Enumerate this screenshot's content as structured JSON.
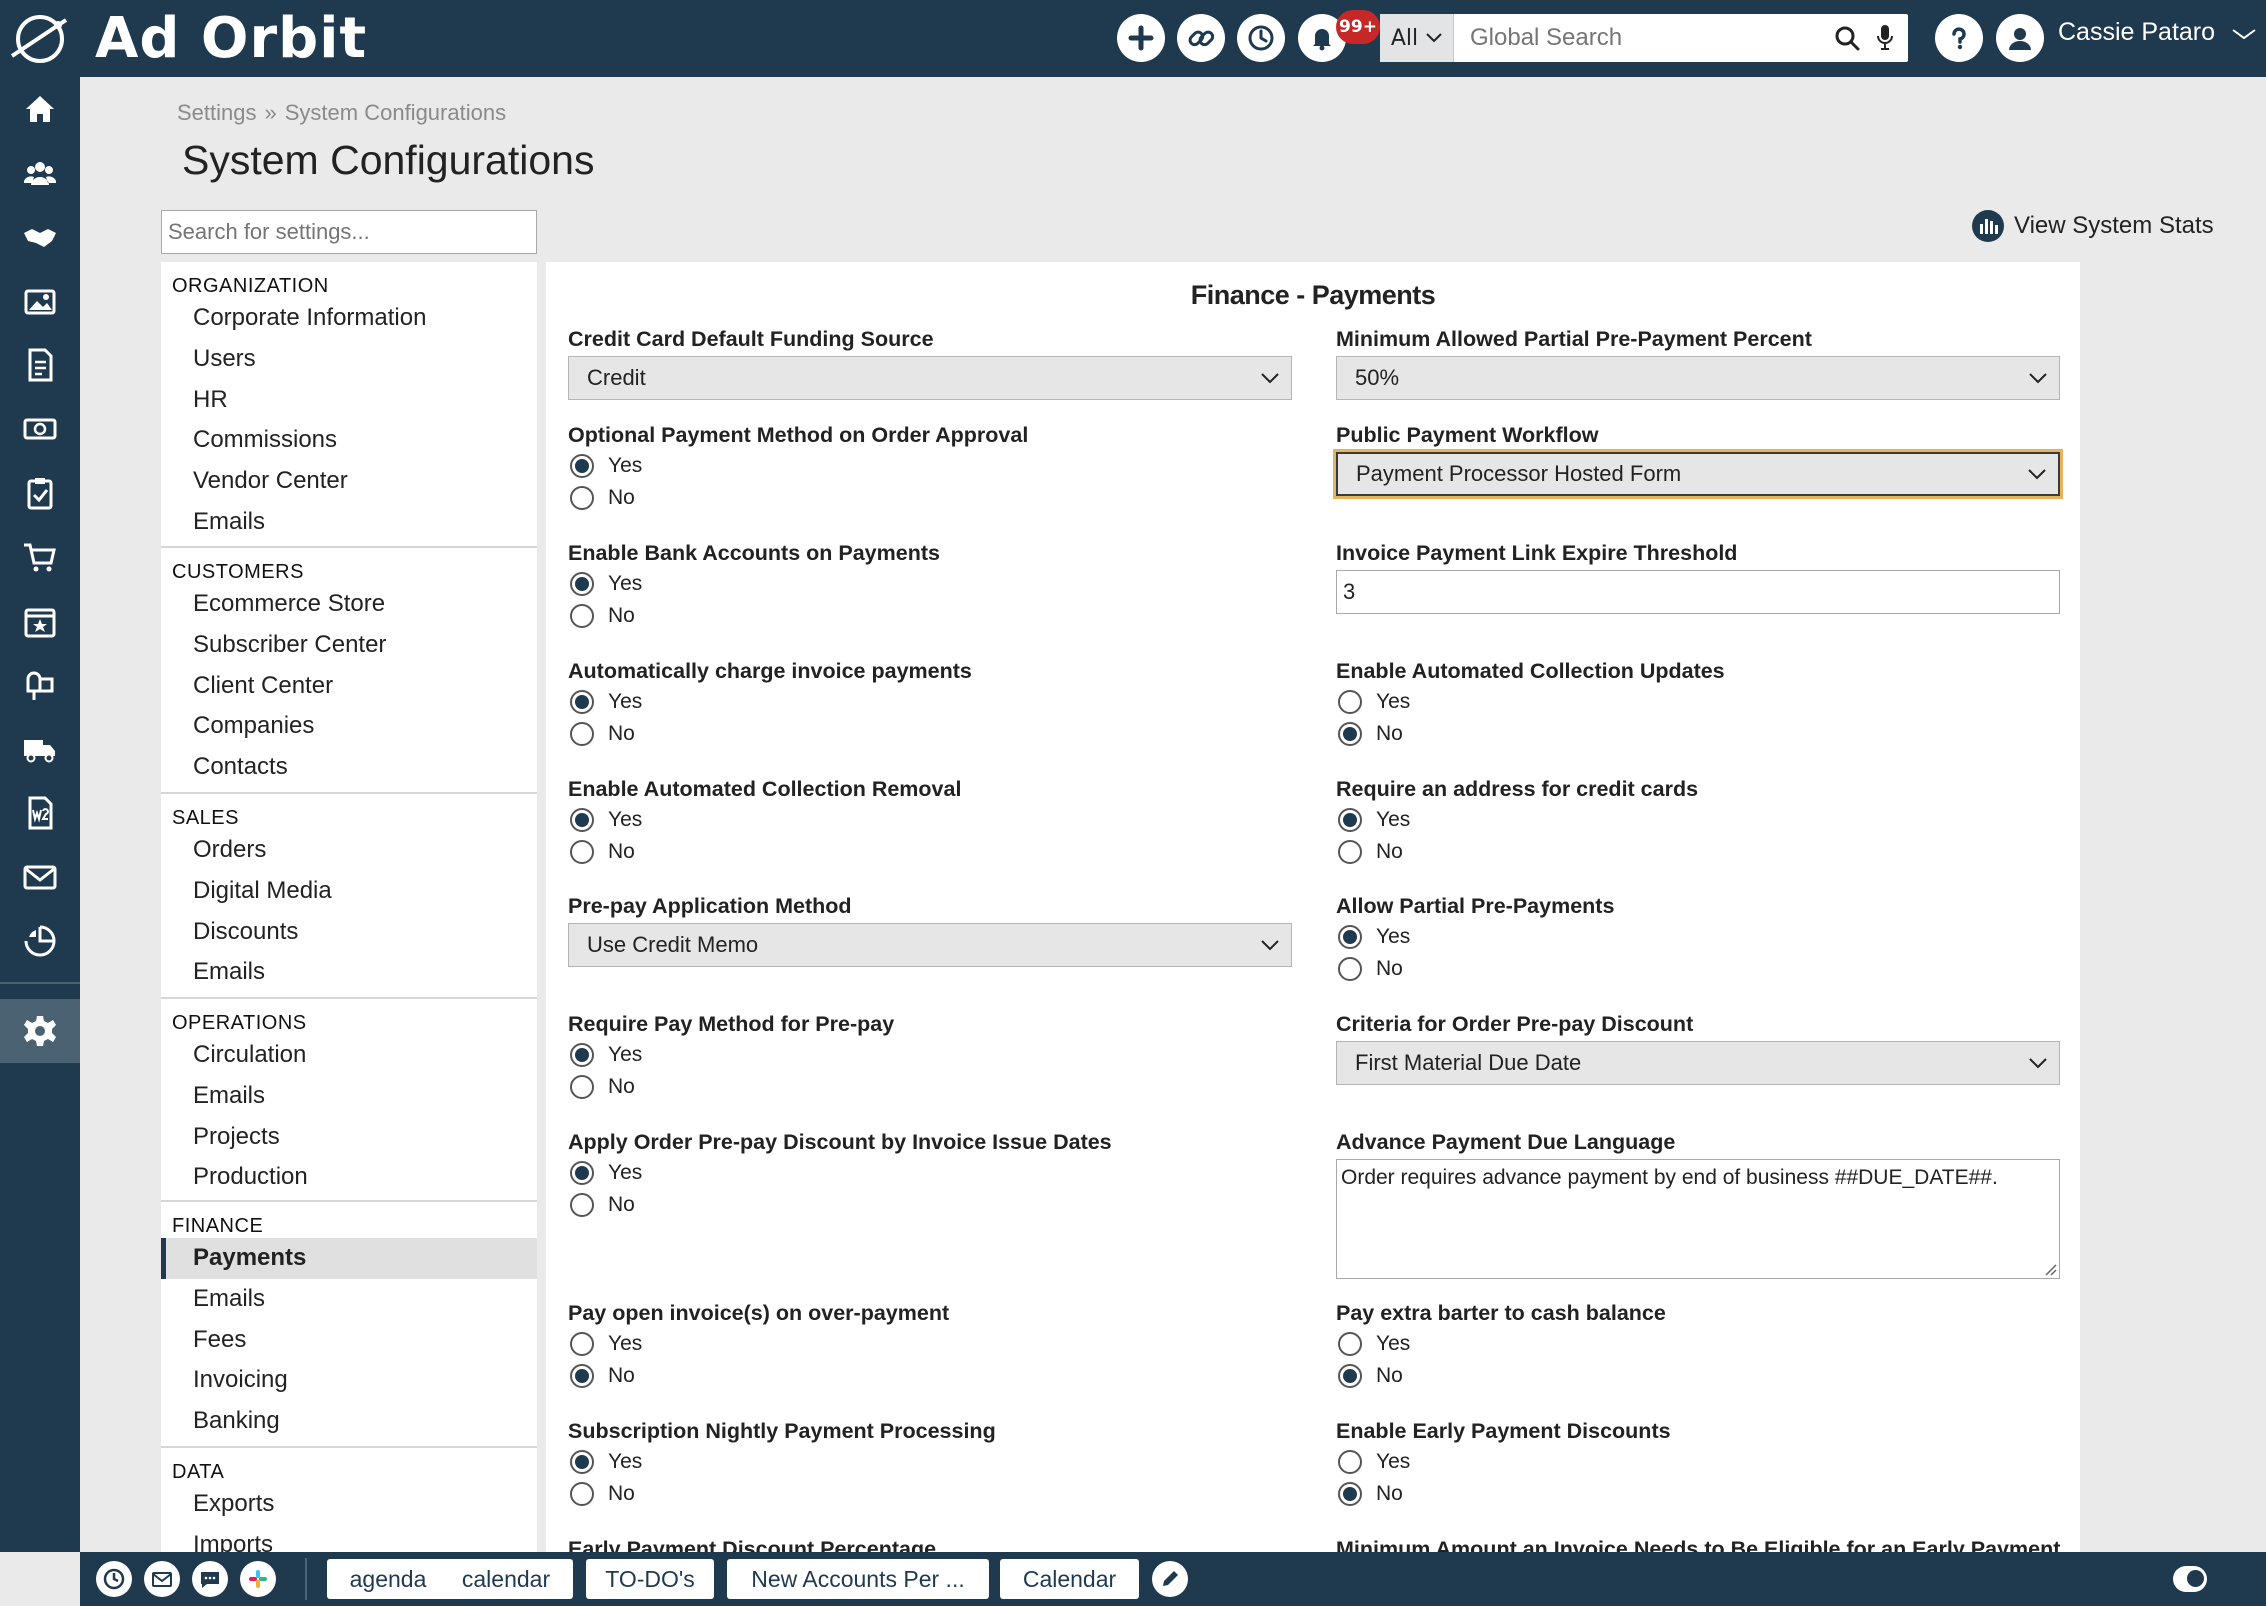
{
  "header": {
    "brand": "Ad Orbit",
    "notifications_badge": "99+",
    "search_scope": "All",
    "search_placeholder": "Global Search",
    "user_name": "Cassie Pataro"
  },
  "breadcrumb": {
    "parent": "Settings",
    "separator": "»",
    "current": "System Configurations"
  },
  "page_title": "System Configurations",
  "settings_search_placeholder": "Search for settings...",
  "view_stats_label": "View System Stats",
  "nav": {
    "organization": {
      "title": "ORGANIZATION",
      "items": [
        "Corporate Information",
        "Users",
        "HR",
        "Commissions",
        "Vendor Center",
        "Emails"
      ]
    },
    "customers": {
      "title": "CUSTOMERS",
      "items": [
        "Ecommerce Store",
        "Subscriber Center",
        "Client Center",
        "Companies",
        "Contacts"
      ]
    },
    "sales": {
      "title": "SALES",
      "items": [
        "Orders",
        "Digital Media",
        "Discounts",
        "Emails"
      ]
    },
    "operations": {
      "title": "OPERATIONS",
      "items": [
        "Circulation",
        "Emails",
        "Projects",
        "Production"
      ]
    },
    "finance": {
      "title": "FINANCE",
      "items": [
        "Payments",
        "Emails",
        "Fees",
        "Invoicing",
        "Banking"
      ]
    },
    "data": {
      "title": "DATA",
      "items": [
        "Exports",
        "Imports"
      ]
    }
  },
  "panel": {
    "title": "Finance - Payments",
    "yes": "Yes",
    "no": "No",
    "fields": {
      "cc_funding": {
        "label": "Credit Card Default Funding Source",
        "value": "Credit"
      },
      "min_partial": {
        "label": "Minimum Allowed Partial Pre-Payment Percent",
        "value": "50%"
      },
      "optional_pay_method": {
        "label": "Optional Payment Method on Order Approval",
        "selected": "Yes"
      },
      "public_workflow": {
        "label": "Public Payment Workflow",
        "value": "Payment Processor Hosted Form"
      },
      "bank_accounts": {
        "label": "Enable Bank Accounts on Payments",
        "selected": "Yes"
      },
      "link_expire": {
        "label": "Invoice Payment Link Expire Threshold",
        "value": "3"
      },
      "auto_charge": {
        "label": "Automatically charge invoice payments",
        "selected": "Yes"
      },
      "auto_collection_updates": {
        "label": "Enable Automated Collection Updates",
        "selected": "No"
      },
      "auto_collection_removal": {
        "label": "Enable Automated Collection Removal",
        "selected": "Yes"
      },
      "require_address": {
        "label": "Require an address for credit cards",
        "selected": "Yes"
      },
      "prepay_method": {
        "label": "Pre-pay Application Method",
        "value": "Use Credit Memo"
      },
      "allow_partial": {
        "label": "Allow Partial Pre-Payments",
        "selected": "Yes"
      },
      "require_pay_method": {
        "label": "Require Pay Method for Pre-pay",
        "selected": "Yes"
      },
      "prepay_criteria": {
        "label": "Criteria for Order Pre-pay Discount",
        "value": "First Material Due Date"
      },
      "apply_discount_dates": {
        "label": "Apply Order Pre-pay Discount by Invoice Issue Dates",
        "selected": "Yes"
      },
      "advance_language": {
        "label": "Advance Payment Due Language",
        "value": "Order requires advance payment by end of business ##DUE_DATE##."
      },
      "pay_open_invoices": {
        "label": "Pay open invoice(s) on over-payment",
        "selected": "No"
      },
      "pay_extra_barter": {
        "label": "Pay extra barter to cash balance",
        "selected": "No"
      },
      "nightly_processing": {
        "label": "Subscription Nightly Payment Processing",
        "selected": "Yes"
      },
      "early_discounts": {
        "label": "Enable Early Payment Discounts",
        "selected": "No"
      },
      "early_pct": {
        "label": "Early Payment Discount Percentage"
      },
      "min_amount": {
        "label": "Minimum Amount an Invoice Needs to Be Eligible for an Early Payment"
      }
    }
  },
  "taskbar": {
    "tabs": [
      "agenda",
      "calendar",
      "TO-DO's",
      "New Accounts Per ...",
      "Calendar"
    ]
  },
  "colors": {
    "primary": "#1f3a4f",
    "badge": "#c62828",
    "focus": "#e8b45a"
  }
}
